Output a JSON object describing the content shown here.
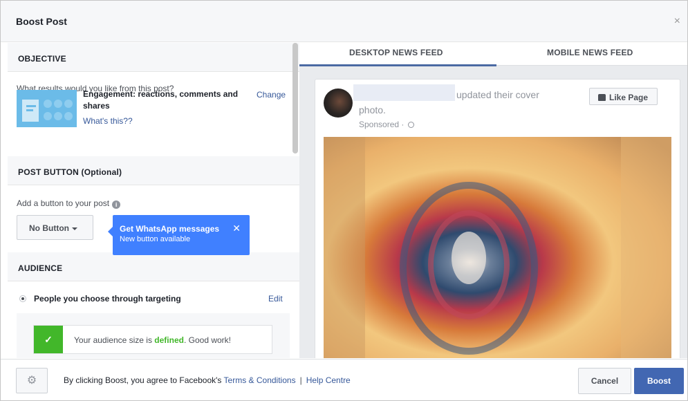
{
  "dialog": {
    "title": "Boost Post",
    "close_icon": "close-icon",
    "close_glyph": "×"
  },
  "objective": {
    "heading": "OBJECTIVE",
    "question": "What results would you like from this post?",
    "selected": "Engagement: reactions, comments and shares",
    "change_link": "Change",
    "whats_this_link": "What's this??"
  },
  "post_button": {
    "heading": "POST BUTTON (Optional)",
    "label": "Add a button to your post",
    "info_glyph": "i",
    "dropdown_value": "No Button",
    "tooltip": {
      "title": "Get WhatsApp messages",
      "subtitle": "New button available",
      "close_glyph": "✕"
    }
  },
  "audience": {
    "heading": "AUDIENCE",
    "option_label": "People you choose through targeting",
    "edit_link": "Edit",
    "status_check_glyph": "✓",
    "status_prefix": "Your audience size is ",
    "status_highlight": "defined",
    "status_suffix": ". Good work!"
  },
  "preview": {
    "tabs": [
      {
        "label": "DESKTOP NEWS FEED",
        "active": true
      },
      {
        "label": "MOBILE NEWS FEED",
        "active": false
      }
    ],
    "post": {
      "action_text_line1": "updated their cover",
      "action_text_line2": "photo.",
      "sponsored": "Sponsored · ",
      "like_page_button": "Like Page"
    }
  },
  "footer": {
    "settings_glyph": "⚙",
    "agreement_prefix": "By clicking Boost, you agree to Facebook's ",
    "terms_link": "Terms & Conditions",
    "separator": "|",
    "help_link": "Help Centre",
    "cancel_button": "Cancel",
    "boost_button": "Boost"
  },
  "colors": {
    "link": "#365899",
    "primary": "#4267b2",
    "tooltip": "#4080ff",
    "success": "#42b72a"
  }
}
